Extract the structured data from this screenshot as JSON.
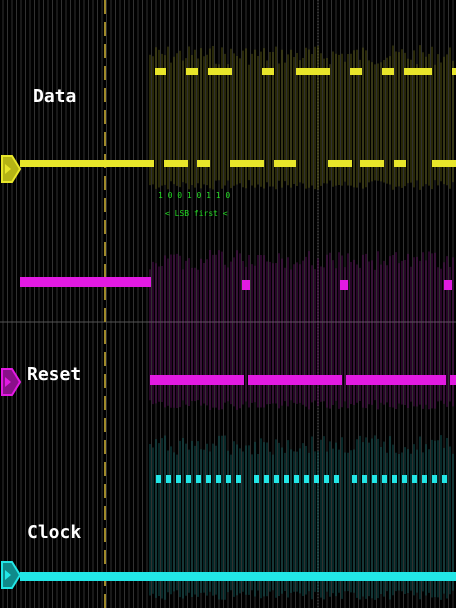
{
  "scope": {
    "channels": [
      {
        "name": "Data",
        "color": "#e8e62a",
        "marker_icon": "channel-arrow-marker-icon"
      },
      {
        "name": "Reset",
        "color": "#e21ae2",
        "marker_icon": "channel-arrow-marker-icon"
      },
      {
        "name": "Clock",
        "color": "#22e6e6",
        "marker_icon": "channel-arrow-marker-icon"
      }
    ],
    "decode": {
      "bits": "1 0 0 1 0 1 1 0",
      "note": "< LSB first <",
      "color": "#22dd22"
    },
    "colors": {
      "background": "#000000",
      "grid": "#3a3a3a",
      "cursor": "#a08a2a"
    }
  }
}
